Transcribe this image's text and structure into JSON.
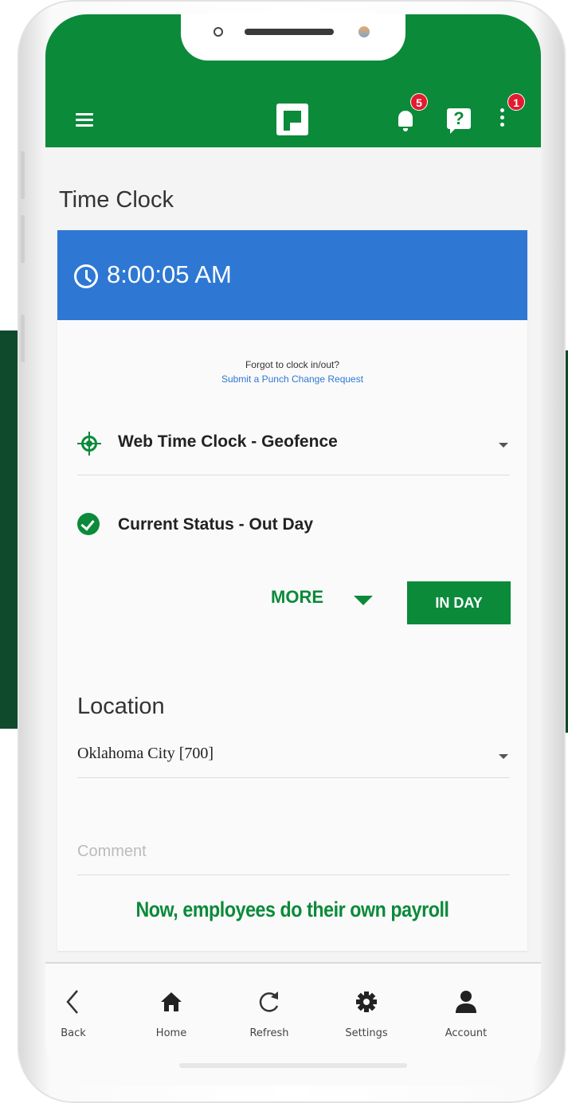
{
  "header": {
    "notifications_badge": "5",
    "more_badge": "1",
    "help_glyph": "?",
    "accent_color": "#0b8a3a",
    "badge_color": "#e21b2e"
  },
  "page": {
    "title": "Time Clock"
  },
  "clock": {
    "time": "8:00:05 AM",
    "bar_color": "#2e78d4",
    "forgot_text": "Forgot to clock in/out?",
    "punch_link": "Submit a Punch Change Request",
    "selected_clock": "Web Time Clock - Geofence",
    "status": "Current Status - Out Day",
    "more_label": "MORE",
    "in_day_label": "IN DAY"
  },
  "location": {
    "label": "Location",
    "value": "Oklahoma City [700]"
  },
  "comment": {
    "placeholder": "Comment"
  },
  "tagline": "Now, employees do their own payroll",
  "bottom_nav": [
    {
      "label": "Back",
      "icon": "back-icon"
    },
    {
      "label": "Home",
      "icon": "home-icon"
    },
    {
      "label": "Refresh",
      "icon": "refresh-icon"
    },
    {
      "label": "Settings",
      "icon": "settings-icon"
    },
    {
      "label": "Account",
      "icon": "account-icon"
    }
  ]
}
